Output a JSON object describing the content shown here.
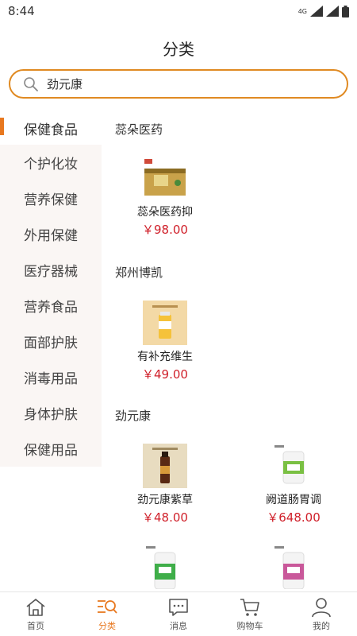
{
  "status_bar": {
    "time": "8:44",
    "network": "4G"
  },
  "header": {
    "title": "分类"
  },
  "search": {
    "value": "劲元康"
  },
  "sidebar": {
    "items": [
      {
        "label": "保健食品",
        "active": true
      },
      {
        "label": "个护化妆",
        "active": false
      },
      {
        "label": "营养保健",
        "active": false
      },
      {
        "label": "外用保健",
        "active": false
      },
      {
        "label": "医疗器械",
        "active": false
      },
      {
        "label": "营养食品",
        "active": false
      },
      {
        "label": "面部护肤",
        "active": false
      },
      {
        "label": "消毒用品",
        "active": false
      },
      {
        "label": "身体护肤",
        "active": false
      },
      {
        "label": "保健用品",
        "active": false
      }
    ]
  },
  "sections": [
    {
      "brand": "蕊朵医药",
      "products": [
        {
          "name": "蕊朵医药抑",
          "price": "￥98.00"
        }
      ]
    },
    {
      "brand": "郑州博凯",
      "products": [
        {
          "name": "有补充维生",
          "price": "￥49.00"
        }
      ]
    },
    {
      "brand": "劲元康",
      "products": [
        {
          "name": "劲元康紫草",
          "price": "￥48.00"
        },
        {
          "name": "阙道肠胃调",
          "price": "￥648.00"
        }
      ]
    }
  ],
  "tab_bar": {
    "items": [
      {
        "label": "首页",
        "icon": "home-icon"
      },
      {
        "label": "分类",
        "icon": "category-search-icon"
      },
      {
        "label": "消息",
        "icon": "message-icon"
      },
      {
        "label": "购物车",
        "icon": "cart-icon"
      },
      {
        "label": "我的",
        "icon": "profile-icon"
      }
    ]
  },
  "colors": {
    "accent": "#e8781f",
    "price": "#d0202a",
    "search_border": "#e08a22"
  }
}
